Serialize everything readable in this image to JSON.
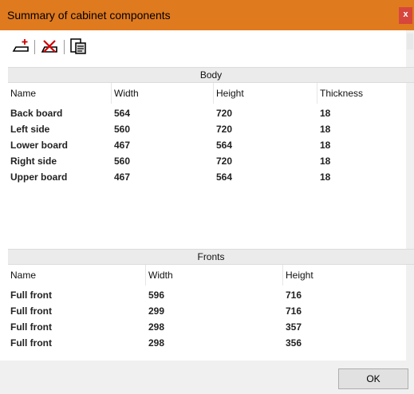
{
  "window": {
    "title": "Summary of cabinet components",
    "close_label": "x"
  },
  "toolbar": {
    "buttons": [
      {
        "icon": "add-component-icon"
      },
      {
        "icon": "delete-component-icon"
      },
      {
        "icon": "copy-clipboard-icon"
      }
    ]
  },
  "body": {
    "title": "Body",
    "columns": [
      "Name",
      "Width",
      "Height",
      "Thickness"
    ],
    "rows": [
      [
        "Back board",
        "564",
        "720",
        "18"
      ],
      [
        "Left side",
        "560",
        "720",
        "18"
      ],
      [
        "Lower board",
        "467",
        "564",
        "18"
      ],
      [
        "Right side",
        "560",
        "720",
        "18"
      ],
      [
        "Upper board",
        "467",
        "564",
        "18"
      ]
    ]
  },
  "fronts": {
    "title": "Fronts",
    "columns": [
      "Name",
      "Width",
      "Height"
    ],
    "rows": [
      [
        "Full front",
        "596",
        "716"
      ],
      [
        "Full front",
        "299",
        "716"
      ],
      [
        "Full front",
        "298",
        "357"
      ],
      [
        "Full front",
        "298",
        "356"
      ]
    ]
  },
  "footer": {
    "ok_label": "OK"
  },
  "colors": {
    "titlebar": "#e07a1f",
    "close_button": "#d6463d"
  }
}
